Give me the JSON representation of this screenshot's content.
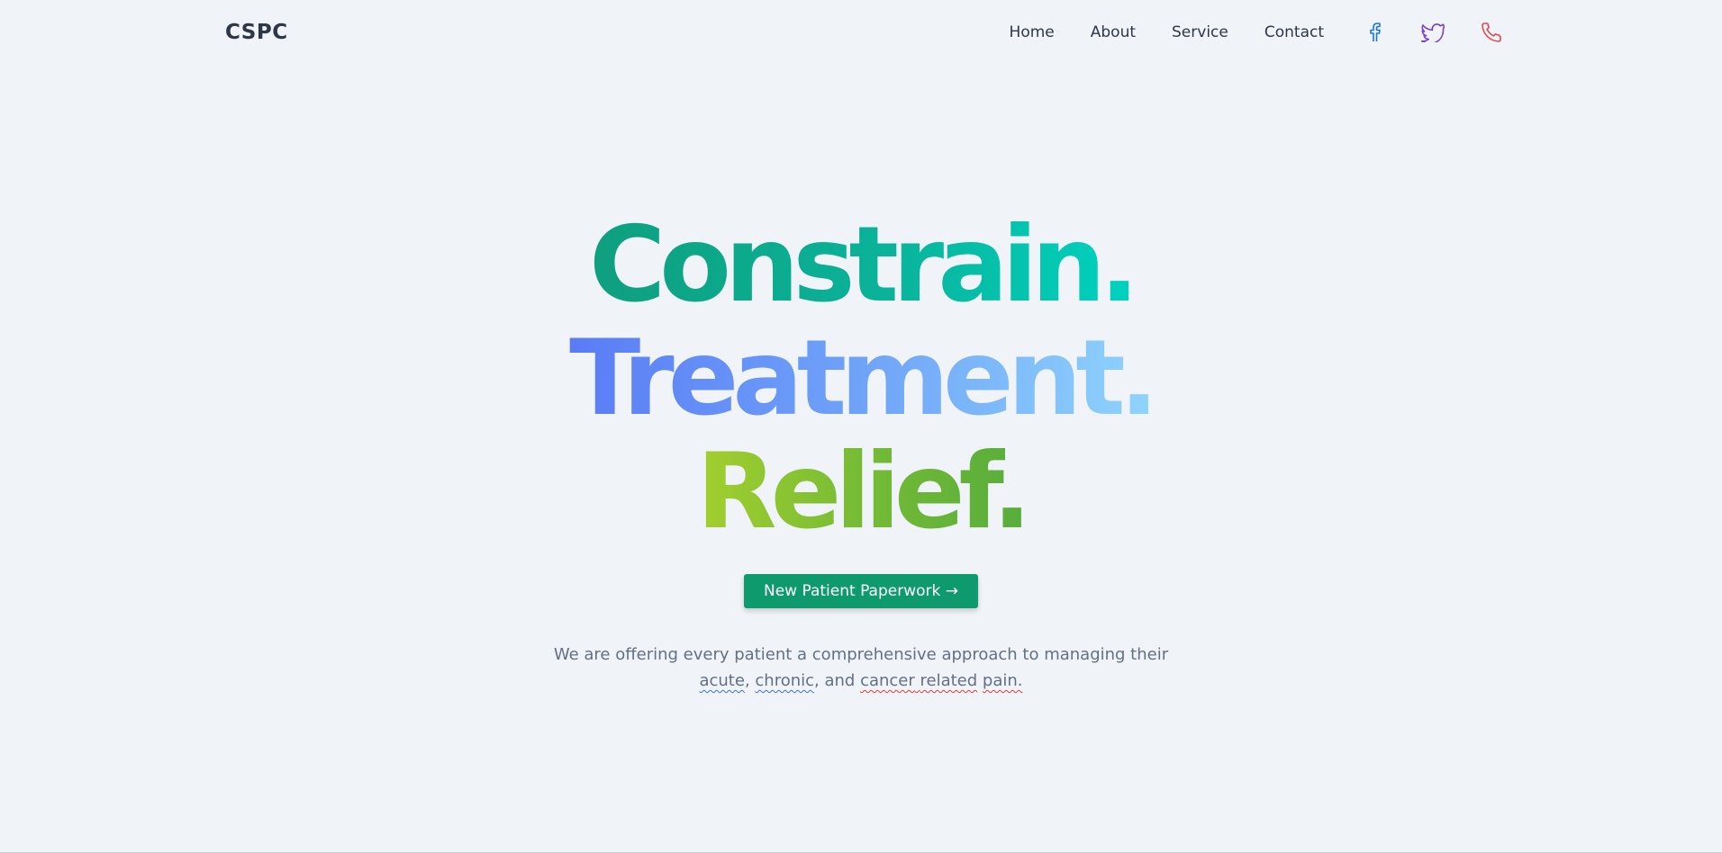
{
  "navbar": {
    "brand": "CSPC",
    "links": [
      {
        "label": "Home"
      },
      {
        "label": "About"
      },
      {
        "label": "Service"
      },
      {
        "label": "Contact"
      }
    ],
    "social": [
      {
        "icon": "facebook-icon",
        "color": "#1d74e0"
      },
      {
        "icon": "twitter-icon",
        "color": "#7b3fc9"
      },
      {
        "icon": "phone-icon",
        "color": "#e04a4a"
      }
    ]
  },
  "hero": {
    "headline": [
      "Constrain.",
      "Treatment.",
      "Relief."
    ],
    "headline_colors": [
      [
        "#0e9f7e",
        "#00d2c0"
      ],
      [
        "#5a7cf6",
        "#8fd4fb"
      ],
      [
        "#a3cf2e",
        "#57ad3c"
      ]
    ],
    "cta_label": "New Patient Paperwork →",
    "cta_color": "#0f9a6e",
    "subtext_line1": "We are offering every patient a comprehensive approach to managing their",
    "subtext_line2": {
      "word1": "acute",
      "sep1": ", ",
      "word2": "chronic",
      "sep2": ", and ",
      "word3": "cancer",
      "sep3": " ",
      "word4": "related",
      "sep4": " ",
      "word5": "pain."
    }
  }
}
